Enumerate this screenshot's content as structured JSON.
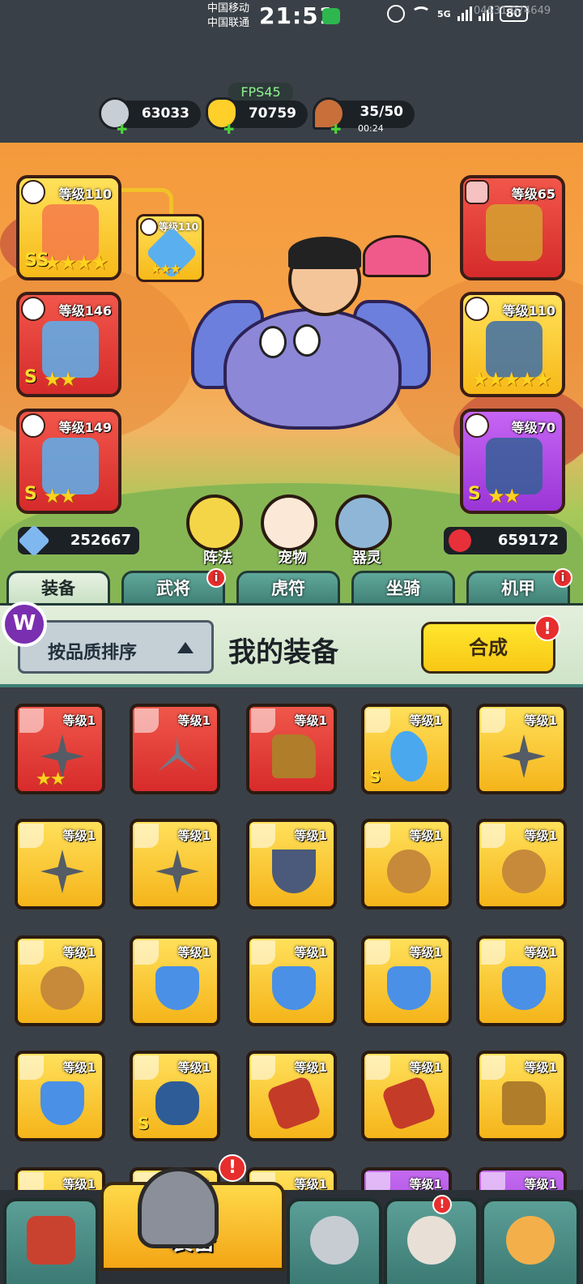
{
  "status_bar": {
    "carrier1": "中国移动",
    "carrier2": "中国联通",
    "time": "21:51",
    "net": "5G",
    "battery": "80",
    "device": "04631 074649"
  },
  "fps": "FPS45",
  "resources": [
    {
      "name": "silver-coin",
      "value": "63033"
    },
    {
      "name": "gold-ingot",
      "value": "70759"
    },
    {
      "name": "meat-stamina",
      "value": "35/50",
      "timer": "00:24"
    }
  ],
  "hero_slots": {
    "left": [
      {
        "level": "等级110",
        "grade": "SS",
        "stars": "★★★★",
        "color": "gold"
      },
      {
        "level": "等级146",
        "grade": "S",
        "stars": "★★",
        "color": "red"
      },
      {
        "level": "等级149",
        "grade": "S",
        "stars": "★★",
        "color": "red"
      }
    ],
    "right": [
      {
        "level": "等级65",
        "grade": "",
        "stars": "",
        "color": "red"
      },
      {
        "level": "等级110",
        "grade": "",
        "stars": "★★★★★",
        "color": "gold"
      },
      {
        "level": "等级70",
        "grade": "S",
        "stars": "★★",
        "color": "purple"
      }
    ],
    "linked": {
      "level": "等级110",
      "stars": "★★★"
    }
  },
  "mini_buttons": [
    {
      "label": "阵法"
    },
    {
      "label": "宠物"
    },
    {
      "label": "器灵"
    }
  ],
  "attack_power": "252667",
  "hp_value": "659172",
  "tabs": [
    {
      "label": "装备",
      "active": true,
      "badge": false
    },
    {
      "label": "武将",
      "active": false,
      "badge": true
    },
    {
      "label": "虎符",
      "active": false,
      "badge": false
    },
    {
      "label": "坐骑",
      "active": false,
      "badge": false
    },
    {
      "label": "机甲",
      "active": false,
      "badge": true
    }
  ],
  "panel": {
    "sort_label": "按品质排序",
    "title": "我的装备",
    "synth_label": "合成",
    "badge": "!"
  },
  "badge_mark": "i",
  "equipment": [
    {
      "level": "等级1",
      "color": "red",
      "art": "shuriken",
      "stars": "★★",
      "grade": ""
    },
    {
      "level": "等级1",
      "color": "red",
      "art": "blade",
      "stars": "",
      "grade": ""
    },
    {
      "level": "等级1",
      "color": "red",
      "art": "boot",
      "stars": "",
      "grade": ""
    },
    {
      "level": "等级1",
      "color": "gold",
      "art": "sword",
      "stars": "",
      "grade": "S"
    },
    {
      "level": "等级1",
      "color": "gold",
      "art": "shuriken",
      "stars": "",
      "grade": ""
    },
    {
      "level": "等级1",
      "color": "gold",
      "art": "shuriken",
      "stars": "",
      "grade": ""
    },
    {
      "level": "等级1",
      "color": "gold",
      "art": "shuriken",
      "stars": "",
      "grade": ""
    },
    {
      "level": "等级1",
      "color": "gold",
      "art": "knife",
      "stars": "",
      "grade": ""
    },
    {
      "level": "等级1",
      "color": "gold",
      "art": "sling",
      "stars": "",
      "grade": ""
    },
    {
      "level": "等级1",
      "color": "gold",
      "art": "sling",
      "stars": "",
      "grade": ""
    },
    {
      "level": "等级1",
      "color": "gold",
      "art": "sling",
      "stars": "",
      "grade": ""
    },
    {
      "level": "等级1",
      "color": "gold",
      "art": "dagger",
      "stars": "",
      "grade": ""
    },
    {
      "level": "等级1",
      "color": "gold",
      "art": "dagger",
      "stars": "",
      "grade": ""
    },
    {
      "level": "等级1",
      "color": "gold",
      "art": "dagger",
      "stars": "",
      "grade": ""
    },
    {
      "level": "等级1",
      "color": "gold",
      "art": "dagger",
      "stars": "",
      "grade": ""
    },
    {
      "level": "等级1",
      "color": "gold",
      "art": "dagger",
      "stars": "",
      "grade": ""
    },
    {
      "level": "等级1",
      "color": "gold",
      "art": "claw",
      "stars": "",
      "grade": "S"
    },
    {
      "level": "等级1",
      "color": "gold",
      "art": "bracer",
      "stars": "",
      "grade": ""
    },
    {
      "level": "等级1",
      "color": "gold",
      "art": "bracer",
      "stars": "",
      "grade": ""
    },
    {
      "level": "等级1",
      "color": "gold",
      "art": "boot",
      "stars": "",
      "grade": ""
    },
    {
      "level": "等级1",
      "color": "gold",
      "art": "dagger",
      "stars": "",
      "grade": ""
    },
    {
      "level": "等级1",
      "color": "gold",
      "art": "dagger",
      "stars": "",
      "grade": ""
    },
    {
      "level": "等级1",
      "color": "gold",
      "art": "dagger",
      "stars": "",
      "grade": ""
    },
    {
      "level": "等级1",
      "color": "purple",
      "art": "dagger",
      "stars": "",
      "grade": ""
    },
    {
      "level": "等级1",
      "color": "purple",
      "art": "dagger",
      "stars": "",
      "grade": ""
    }
  ],
  "bottom_nav": [
    {
      "name": "city",
      "label": ""
    },
    {
      "name": "equipment",
      "label": "装备",
      "active": true
    },
    {
      "name": "battle",
      "label": ""
    },
    {
      "name": "hero",
      "label": ""
    },
    {
      "name": "upgrade",
      "label": ""
    }
  ],
  "colors": {
    "gold": "#f7b918",
    "red": "#d52b2b",
    "purple": "#9a35d6",
    "accent_green": "#3f7e74",
    "badge_red": "#e82d2d"
  }
}
